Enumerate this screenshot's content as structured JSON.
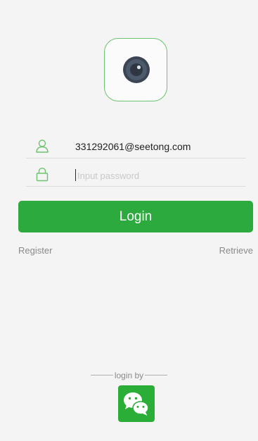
{
  "logo": {
    "icon": "camera-lens-icon",
    "border_color": "#6cc36f"
  },
  "form": {
    "email_value": "331292061@seetong.com",
    "password_placeholder": "Input password",
    "user_icon": "user-icon",
    "lock_icon": "lock-icon",
    "icon_color": "#6cc36f"
  },
  "actions": {
    "login_label": "Login",
    "register_label": "Register",
    "retrieve_label": "Retrieve",
    "accent": "#2daa3d"
  },
  "social": {
    "login_by_label": "login by",
    "wechat_icon": "wechat-icon",
    "wechat_color": "#2aae37"
  }
}
